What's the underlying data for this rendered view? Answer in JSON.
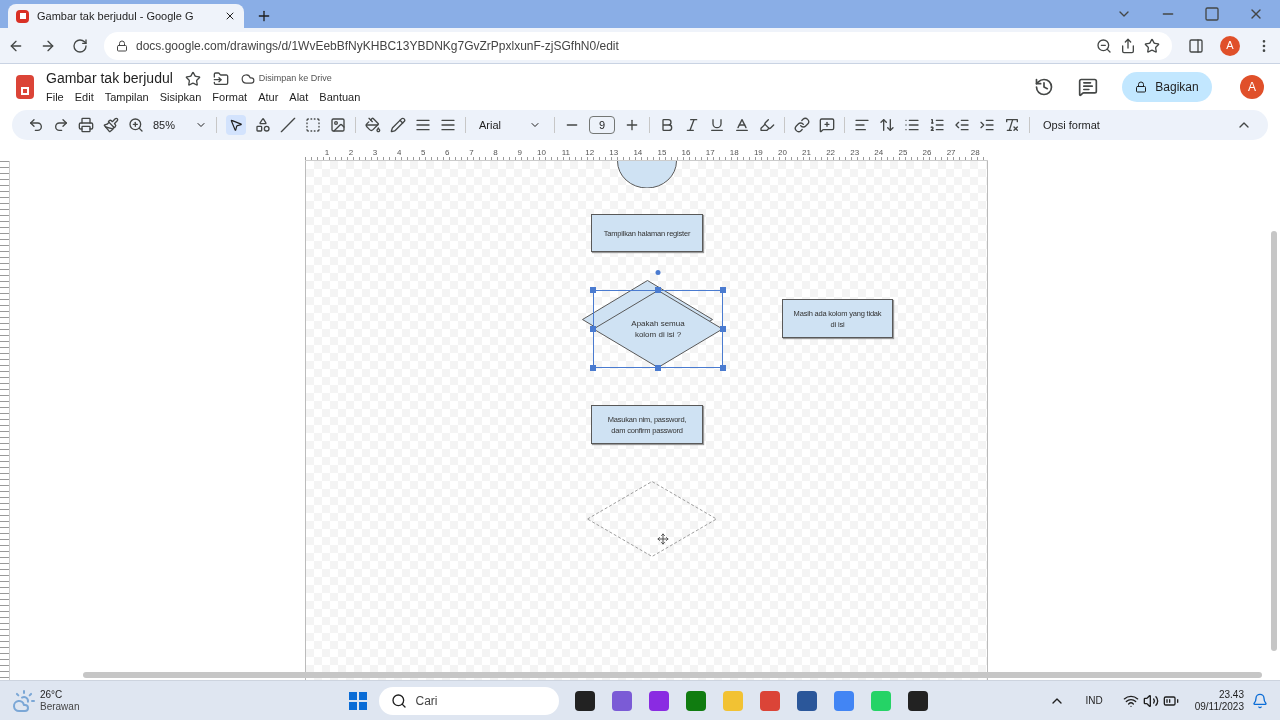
{
  "browser": {
    "tab_title": "Gambar tak berjudul - Google G",
    "url": "docs.google.com/drawings/d/1WvEebBfNyKHBC13YBDNKg7GvZrPpxlxunF-zjSGfhN0/edit",
    "profile": "A"
  },
  "document": {
    "title": "Gambar tak berjudul",
    "saved_status": "Disimpan ke Drive",
    "menu": [
      "File",
      "Edit",
      "Tampilan",
      "Sisipkan",
      "Format",
      "Atur",
      "Alat",
      "Bantuan"
    ],
    "share_button": "Bagikan",
    "avatar": "A"
  },
  "toolbar": {
    "zoom": "85%",
    "font": "Arial",
    "font_size": "9",
    "format_options": "Opsi format"
  },
  "ruler": [
    "1",
    "2",
    "3",
    "4",
    "5",
    "6",
    "7",
    "8",
    "9",
    "10",
    "11",
    "12",
    "13",
    "14",
    "15",
    "16",
    "17",
    "18",
    "19",
    "20",
    "21",
    "22",
    "23",
    "24",
    "25",
    "26",
    "27",
    "28"
  ],
  "shapes": [
    {
      "kind": "terminal",
      "selected": false,
      "filled": true
    },
    {
      "kind": "process",
      "text": "Tampilkan halaman register",
      "selected": false,
      "filled": true
    },
    {
      "kind": "decision",
      "selected": false,
      "filled": true
    },
    {
      "kind": "decision",
      "text": "Apakah semua kolom di isi ?",
      "selected": true,
      "filled": true
    },
    {
      "kind": "process",
      "text": "Masih ada kolom yang tidak di isi",
      "selected": false,
      "filled": true
    },
    {
      "kind": "process",
      "text": "Masukan nim, password, dam confirm password",
      "selected": false,
      "filled": true
    },
    {
      "kind": "decision",
      "selected": false,
      "filled": false
    }
  ],
  "taskbar": {
    "temperature": "26°C",
    "weather": "Berawan",
    "search_placeholder": "Cari",
    "language": "IND",
    "time": "23.43",
    "date": "09/11/2023"
  }
}
